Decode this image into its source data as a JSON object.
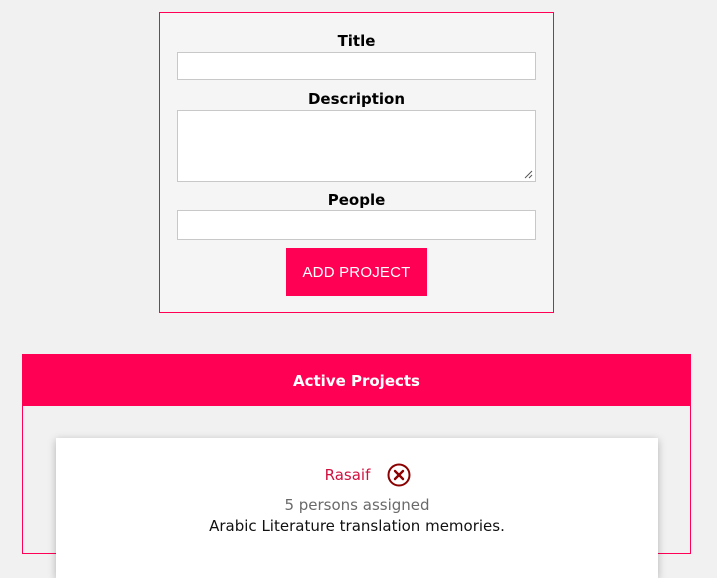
{
  "form": {
    "title_label": "Title",
    "title_value": "",
    "description_label": "Description",
    "description_value": "",
    "people_label": "People",
    "people_value": "",
    "add_button_label": "ADD PROJECT"
  },
  "projects": {
    "header": "Active Projects",
    "items": [
      {
        "title": "Rasaif",
        "people": "5 persons assigned",
        "description": "Arabic Literature translation memories.",
        "icon": "close-circle-icon"
      }
    ]
  },
  "colors": {
    "accent": "#ff0055",
    "project_title": "#d0103f",
    "delete_icon": "#8b0000"
  }
}
